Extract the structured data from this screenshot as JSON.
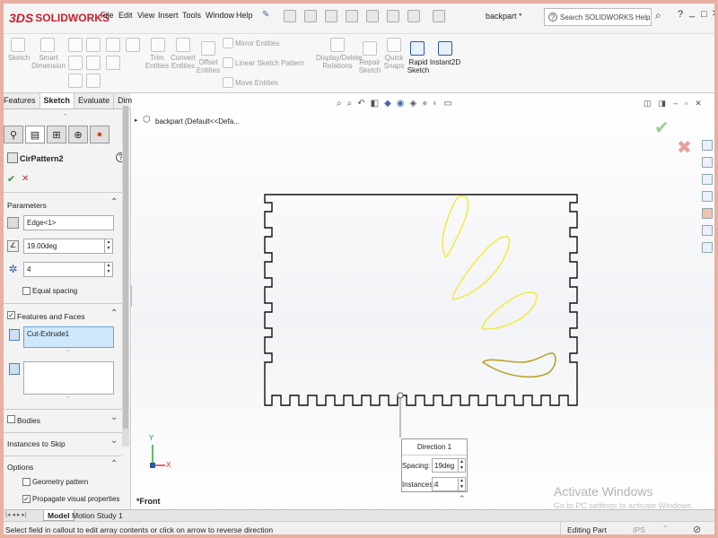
{
  "app": {
    "brand": "SOLIDWORKS",
    "brand_mark": "3DS",
    "menu": [
      "File",
      "Edit",
      "View",
      "Insert",
      "Tools",
      "Window",
      "Help"
    ],
    "document_title": "backpart *",
    "search_placeholder": "Search SOLIDWORKS Help",
    "help": "?",
    "colors": {
      "brand": "#c8202e",
      "accent_select": "#cfe8fb",
      "sketch_yellow": "#f0eb4a"
    }
  },
  "command_manager": {
    "sketch": "Sketch",
    "smart_dimension": "Smart Dimension",
    "trim_entities": "Trim Entities",
    "convert_entities": "Convert Entities",
    "offset_entities": "Offset Entities",
    "mirror_entities": "Mirror Entities",
    "linear_sketch_pattern": "Linear Sketch Pattern",
    "move_entities": "Move Entities",
    "display_delete_relations": "Display/Delete Relations",
    "repair_sketch": "Repair Sketch",
    "quick_snaps": "Quick Snaps",
    "rapid_sketch": "Rapid Sketch",
    "instant2d": "Instant2D"
  },
  "tabs": [
    "Features",
    "Sketch",
    "Evaluate",
    "DimXpert"
  ],
  "property_manager": {
    "title": "CirPattern2",
    "help": "?",
    "ok": "✔",
    "cancel": "✕",
    "parameters": {
      "label": "Parameters",
      "edge": "Edge<1>",
      "angle": "19.00deg",
      "count": "4",
      "equal_spacing": "Equal spacing"
    },
    "features_faces": {
      "label": "Features and Faces",
      "selected": "Cut-Extrude1"
    },
    "bodies": "Bodies",
    "instances_to_skip": "Instances to Skip",
    "options": {
      "label": "Options",
      "geometry_pattern": "Geometry pattern",
      "propagate": "Propagate visual properties"
    }
  },
  "graphics": {
    "tree_item": "backpart  (Default<<Defa...",
    "view_label": "*Front",
    "callout": {
      "title": "Direction 1",
      "spacing_label": "Spacing:",
      "spacing_value": "19deg",
      "instances_label": "Instances:",
      "instances_value": "4"
    },
    "watermark_title": "Activate Windows",
    "watermark_sub": "Go to PC settings to activate Windows.",
    "axis_y": "Y",
    "axis_x": "X"
  },
  "bottom_tabs": {
    "model": "Model",
    "motion_study": "Motion Study 1"
  },
  "status": {
    "message": "Select field in callout to edit array contents or click on arrow to reverse direction",
    "mode": "Editing Part",
    "units": "IPS"
  }
}
